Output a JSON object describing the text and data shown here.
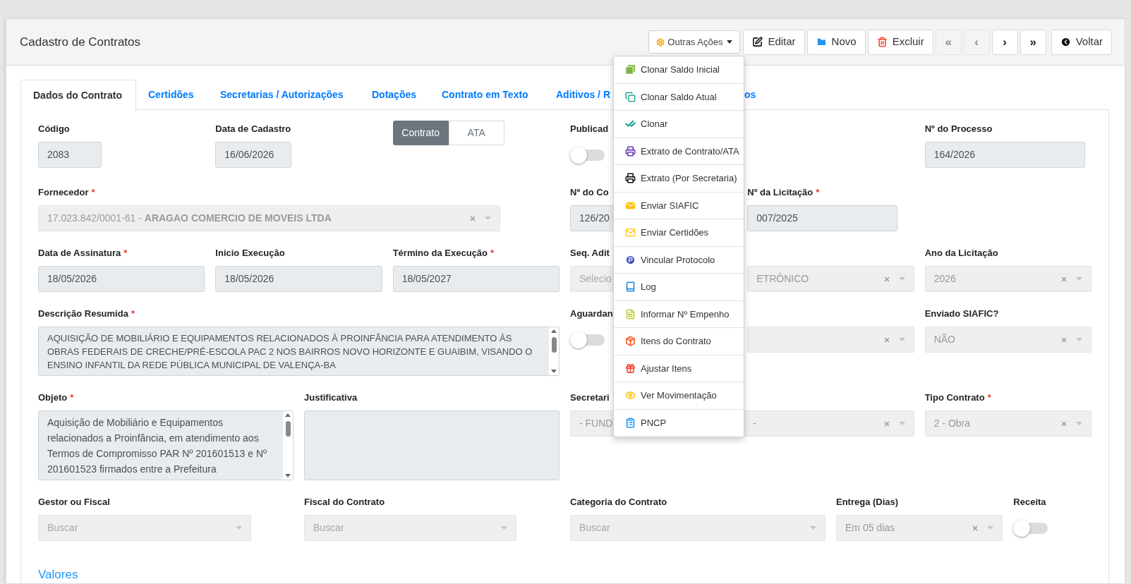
{
  "header": {
    "title": "Cadastro de Contratos"
  },
  "toolbar": [
    {
      "kind": "dropdown",
      "label": "Outras Ações",
      "expanded": true
    },
    {
      "kind": "button",
      "label": "Editar"
    },
    {
      "kind": "button",
      "label": "Novo"
    },
    {
      "kind": "button",
      "label": "Excluir"
    },
    {
      "kind": "nav",
      "label": "«",
      "disabled": true
    },
    {
      "kind": "nav",
      "label": "‹",
      "disabled": true
    },
    {
      "kind": "nav",
      "label": "›",
      "disabled": false
    },
    {
      "kind": "nav",
      "label": "»",
      "disabled": false
    },
    {
      "kind": "button",
      "label": "Voltar"
    }
  ],
  "menu": [
    "Clonar Saldo Inicial",
    "Clonar Saldo Atual",
    "Clonar",
    "Extrato de Contrato/ATA",
    "Extrato (Por Secretaria)",
    "Enviar SIAFIC",
    "Enviar Certidões",
    "Vincular Protocolo",
    "Log",
    "Informar Nº Empenho",
    "Itens do Contrato",
    "Ajustar Itens",
    "Ver Movimentação",
    "PNCP"
  ],
  "tabs": [
    {
      "label": "Dados do Contrato",
      "selected": true
    },
    {
      "label": "Certidões",
      "selected": false
    },
    {
      "label": "Secretarias / Autorizações",
      "selected": false
    },
    {
      "label": "Dotações",
      "selected": false
    },
    {
      "label": "Contrato em Texto",
      "selected": false
    },
    {
      "label": "Aditivos / R",
      "selected": false
    },
    {
      "label": "os",
      "selected": false
    }
  ],
  "fields": [
    {
      "kind": "input",
      "label": "Código",
      "value": "2083"
    },
    {
      "kind": "input",
      "label": "Data de Cadastro",
      "value": "16/06/2026"
    },
    {
      "kind": "segmented",
      "options": [
        {
          "label": "Contrato",
          "selected": true
        },
        {
          "label": "ATA",
          "selected": false
        }
      ]
    },
    {
      "kind": "toggle",
      "label": "Publicad",
      "on": false
    },
    {
      "kind": "input",
      "label": "Nº do Processo",
      "value": "164/2026"
    },
    {
      "kind": "select",
      "label": "Fornecedor",
      "mark": "*",
      "value": "17.023.842/0001-61 - **ARAGAO COMERCIO DE MOVEIS LTDA**",
      "clearable": true
    },
    {
      "kind": "input",
      "label": "Nº do Co",
      "value": "126/20"
    },
    {
      "kind": "input",
      "label": "Nº da Licitação",
      "mark": "*",
      "value": "007/2025"
    },
    {
      "kind": "input",
      "label": "Data de Assinatura",
      "mark": "*",
      "value": "18/05/2026"
    },
    {
      "kind": "input",
      "label": "Inicio Execução",
      "value": "18/05/2026"
    },
    {
      "kind": "input",
      "label": "Término da Execução",
      "mark": "*",
      "value": "18/05/2027"
    },
    {
      "kind": "select",
      "label": "Seq. Adit",
      "placeholder": "Selecio",
      "clearable": false
    },
    {
      "kind": "select",
      "value": "ETRÔNICO",
      "clearable": true
    },
    {
      "kind": "select",
      "label": "Ano da Licitação",
      "value": "2026",
      "clearable": true
    },
    {
      "kind": "textarea",
      "label": "Descrição Resumida",
      "mark": "*",
      "value": "AQUISIÇÃO DE MOBILIÁRIO E EQUIPAMENTOS RELACIONADOS À PROINFÂNCIA PARA ATENDIMENTO ÀS OBRAS FEDERAIS DE CRECHE/PRÉ-ESCOLA PAC 2 NOS BAIRROS NOVO HORIZONTE E GUAIBIM, VISANDO O ENSINO INFANTIL DA REDE PÚBLICA MUNICIPAL DE VALENÇA-BA"
    },
    {
      "kind": "toggle",
      "label": "Aguardan",
      "on": false
    },
    {
      "kind": "select",
      "clearable": true
    },
    {
      "kind": "select",
      "label": "Enviado SIAFIC?",
      "value": "NÃO",
      "clearable": true
    },
    {
      "kind": "textarea",
      "label": "Objeto",
      "mark": "*",
      "value": "Aquisição de Mobiliário e Equipamentos relacionados a Proinfância, em atendimento aos Termos de Compromisso PAR Nº 201601513 e Nº 201601523 firmados entre a Prefeitura"
    },
    {
      "kind": "textarea",
      "label": "Justificativa"
    },
    {
      "kind": "select",
      "label": "Secretari",
      "value": "- FUND",
      "value_end": "-",
      "clearable": true
    },
    {
      "kind": "select",
      "label": "Tipo Contrato",
      "mark": "*",
      "value": "2 - Obra",
      "clearable": true
    },
    {
      "kind": "select",
      "label": "Gestor ou Fiscal",
      "placeholder": "Buscar",
      "clearable": false
    },
    {
      "kind": "select",
      "label": "Fiscal do Contrato",
      "placeholder": "Buscar",
      "clearable": false
    },
    {
      "kind": "select",
      "label": "Categoria do Contrato",
      "placeholder": "Buscar",
      "clearable": false
    },
    {
      "kind": "select",
      "label": "Entrega (Dias)",
      "value": "Em 05 dias",
      "clearable": true
    },
    {
      "kind": "toggle",
      "label": "Receita",
      "on": false
    }
  ],
  "section_link": "Valores"
}
